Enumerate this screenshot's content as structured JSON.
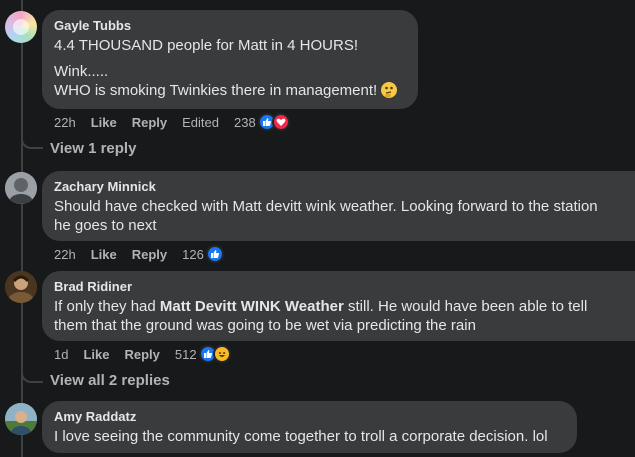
{
  "comments": [
    {
      "author": "Gayle Tubbs",
      "lines": [
        "4.4 THOUSAND people for Matt in 4 HOURS!",
        "Wink.....",
        "WHO is smoking Twinkies there in management!"
      ],
      "emoji": "thinking-face",
      "time": "22h",
      "like_label": "Like",
      "reply_label": "Reply",
      "edited_label": "Edited",
      "reaction_count": "238",
      "reactions": [
        "like",
        "love"
      ],
      "view_replies": "View 1 reply"
    },
    {
      "author": "Zachary Minnick",
      "lines": [
        "Should have checked with Matt devitt wink weather. Looking forward to the station",
        "he goes to next"
      ],
      "time": "22h",
      "like_label": "Like",
      "reply_label": "Reply",
      "reaction_count": "126",
      "reactions": [
        "like"
      ]
    },
    {
      "author": "Brad Ridiner",
      "line1_before": "If only they had ",
      "line1_mention": "Matt Devitt WINK Weather",
      "line1_after": " still. He would have been able to tell",
      "line2": "them that the ground was going to be wet via predicting the rain",
      "time": "1d",
      "like_label": "Like",
      "reply_label": "Reply",
      "reaction_count": "512",
      "reactions": [
        "like",
        "haha"
      ],
      "view_replies": "View all 2 replies"
    },
    {
      "author": "Amy Raddatz",
      "lines": [
        "I love seeing the community come together to troll a corporate decision. lol"
      ]
    }
  ],
  "colors": {
    "background": "#18191a",
    "bubble": "#3a3b3c",
    "text": "#e4e6eb",
    "secondary": "#b0b3b8",
    "like_blue": "#1877f2",
    "love_red": "#f0284a",
    "haha_yellow": "#f7b928"
  }
}
